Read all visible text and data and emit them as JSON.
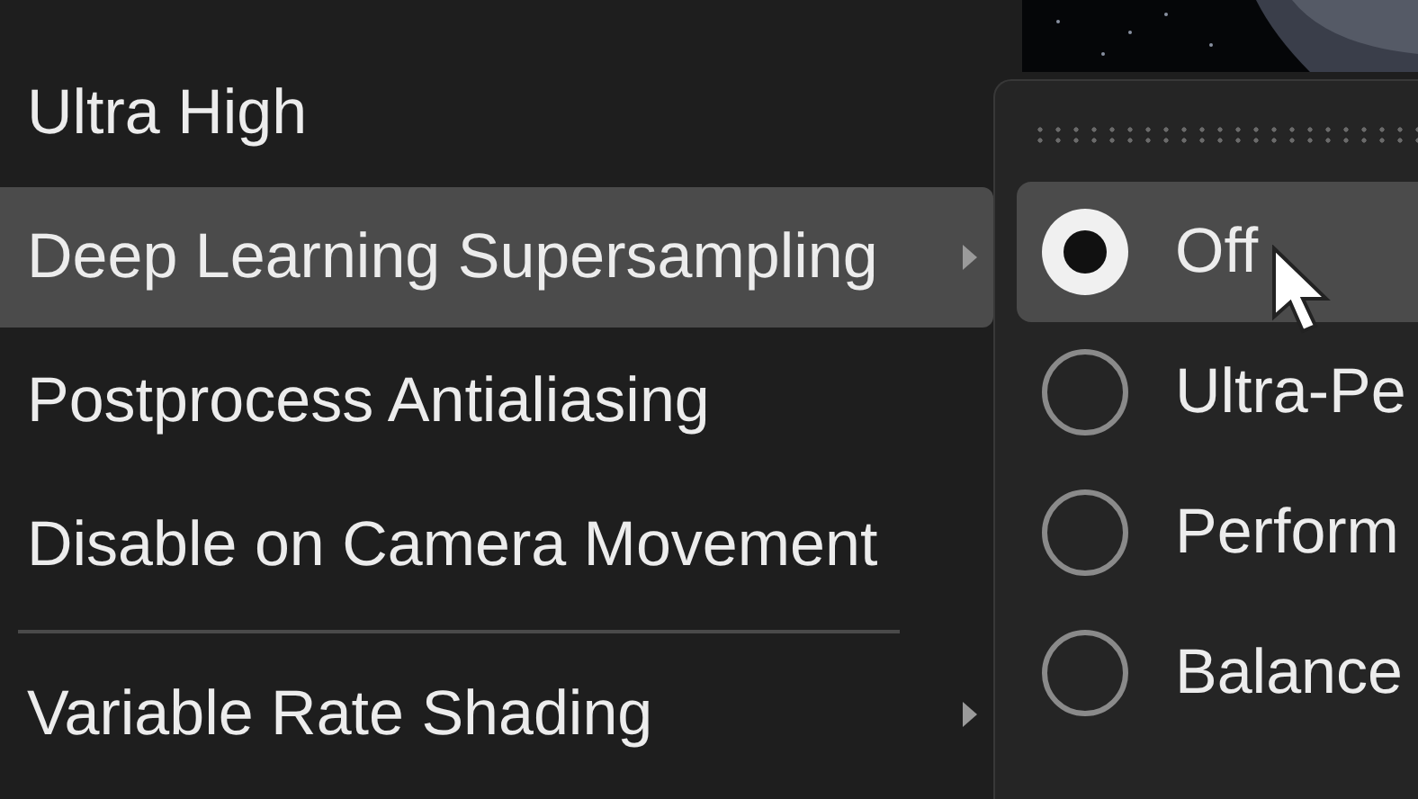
{
  "menu": {
    "items": [
      {
        "kind": "item",
        "label": "Ultra High",
        "hovered": false,
        "submenu": false
      },
      {
        "kind": "item",
        "label": "Deep Learning Supersampling",
        "hovered": true,
        "submenu": true
      },
      {
        "kind": "item",
        "label": "Postprocess Antialiasing",
        "hovered": false,
        "submenu": false
      },
      {
        "kind": "item",
        "label": "Disable on Camera Movement",
        "hovered": false,
        "submenu": false
      },
      {
        "kind": "separator"
      },
      {
        "kind": "item",
        "label": "Variable Rate Shading",
        "hovered": false,
        "submenu": true
      }
    ]
  },
  "submenu": {
    "items": [
      {
        "label": "Off",
        "selected": true,
        "hovered": true
      },
      {
        "label": "Ultra-Pe",
        "selected": false,
        "hovered": false
      },
      {
        "label": "Perform",
        "selected": false,
        "hovered": false
      },
      {
        "label": "Balance",
        "selected": false,
        "hovered": false
      }
    ]
  }
}
